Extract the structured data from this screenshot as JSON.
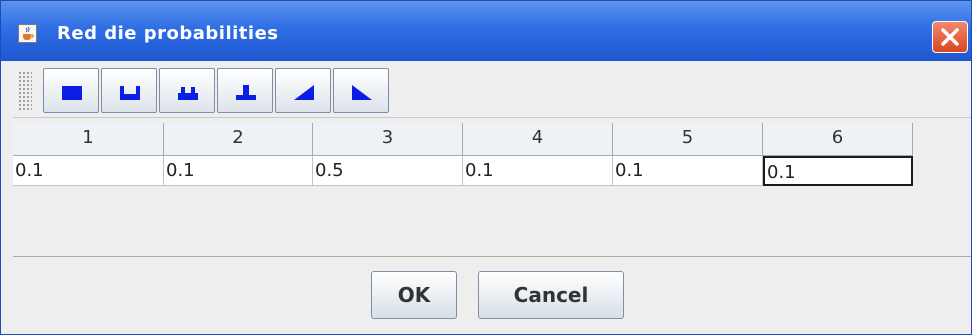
{
  "window": {
    "title": "Red die probabilities",
    "icon": "java-coffee-icon",
    "close_icon": "close-x-icon"
  },
  "toolbar": {
    "buttons": [
      {
        "icon": "uniform-distribution-icon"
      },
      {
        "icon": "u-shaped-distribution-icon"
      },
      {
        "icon": "bimodal-distribution-icon"
      },
      {
        "icon": "peaked-distribution-icon"
      },
      {
        "icon": "increasing-distribution-icon"
      },
      {
        "icon": "decreasing-distribution-icon"
      }
    ]
  },
  "table": {
    "headers": [
      "1",
      "2",
      "3",
      "4",
      "5",
      "6"
    ],
    "values": [
      "0.1",
      "0.1",
      "0.5",
      "0.1",
      "0.1",
      "0.1"
    ]
  },
  "buttons": {
    "ok": "OK",
    "cancel": "Cancel"
  },
  "colors": {
    "titlebar": "#2f6ee4",
    "toolbar_icon": "#0a1ee6",
    "close_button": "#e05a35"
  }
}
